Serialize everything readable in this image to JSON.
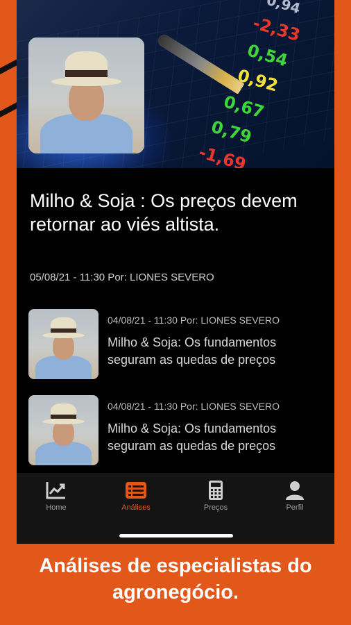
{
  "featured": {
    "title": "Milho & Soja : Os preços devem retornar ao viés altista.",
    "meta": "05/08/21 - 11:30 Por: LIONES SEVERO"
  },
  "hero_tickers": [
    "-2,33",
    "0,54",
    "0,92",
    "0,67",
    "0,79",
    "-1,69",
    "0,94"
  ],
  "items": [
    {
      "meta": "04/08/21 - 11:30 Por: LIONES SEVERO",
      "title": "Milho & Soja: Os fundamentos seguram as quedas de preços"
    },
    {
      "meta": "04/08/21 - 11:30 Por: LIONES SEVERO",
      "title": "Milho & Soja: Os fundamentos seguram as quedas de preços"
    }
  ],
  "nav": [
    {
      "label": "Home",
      "icon": "chart-line-icon",
      "active": false
    },
    {
      "label": "Análises",
      "icon": "list-icon",
      "active": true
    },
    {
      "label": "Preços",
      "icon": "calculator-icon",
      "active": false
    },
    {
      "label": "Perfil",
      "icon": "user-icon",
      "active": false
    }
  ],
  "caption": "Análises de especialistas do agronegócio.",
  "colors": {
    "accent": "#E2581A",
    "background": "#000000",
    "nav_bg": "#141414"
  }
}
